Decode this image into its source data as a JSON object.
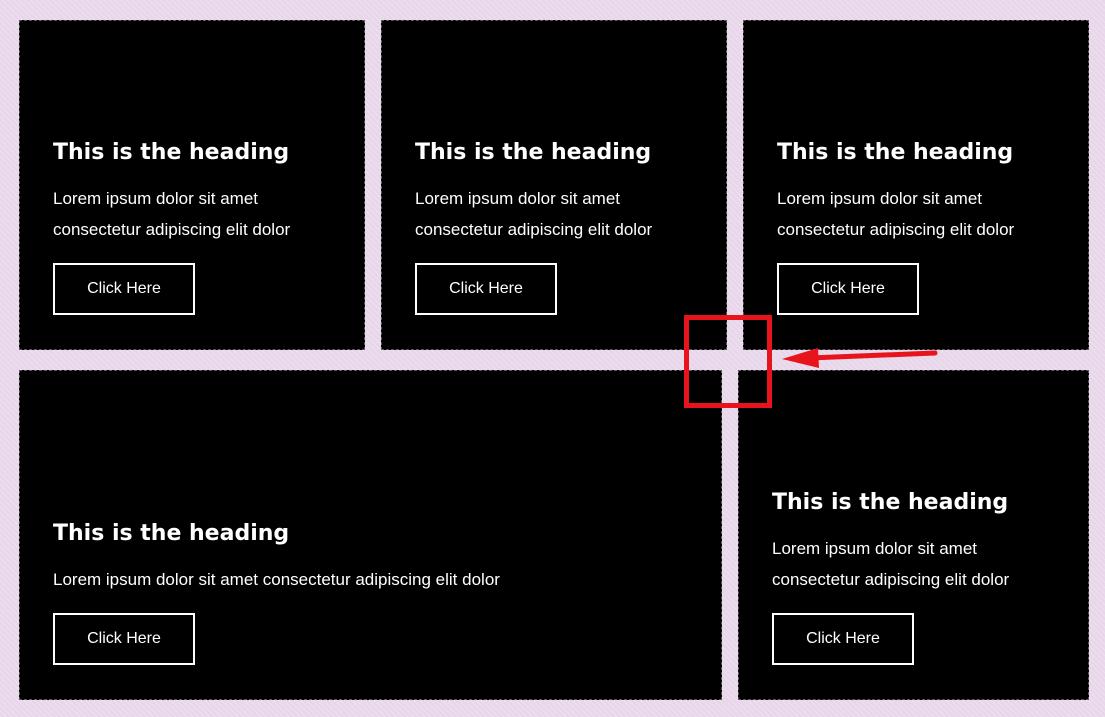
{
  "cards": [
    {
      "heading": "This is the heading",
      "text": "Lorem ipsum dolor sit amet consectetur adipiscing elit dolor",
      "button": "Click Here"
    },
    {
      "heading": "This is the heading",
      "text": "Lorem ipsum dolor sit amet consectetur adipiscing elit dolor",
      "button": "Click Here"
    },
    {
      "heading": "This is the heading",
      "text": "Lorem ipsum dolor sit amet consectetur adipiscing elit dolor",
      "button": "Click Here"
    },
    {
      "heading": "This is the heading",
      "text": "Lorem ipsum dolor sit amet consectetur adipiscing elit dolor",
      "button": "Click Here"
    },
    {
      "heading": "This is the heading",
      "text": "Lorem ipsum dolor sit amet consectetur adipiscing elit dolor",
      "button": "Click Here"
    }
  ],
  "colors": {
    "page_background": "#e8d6ea",
    "card_background": "#000000",
    "text": "#ffffff",
    "annotation": "#e8141c"
  }
}
